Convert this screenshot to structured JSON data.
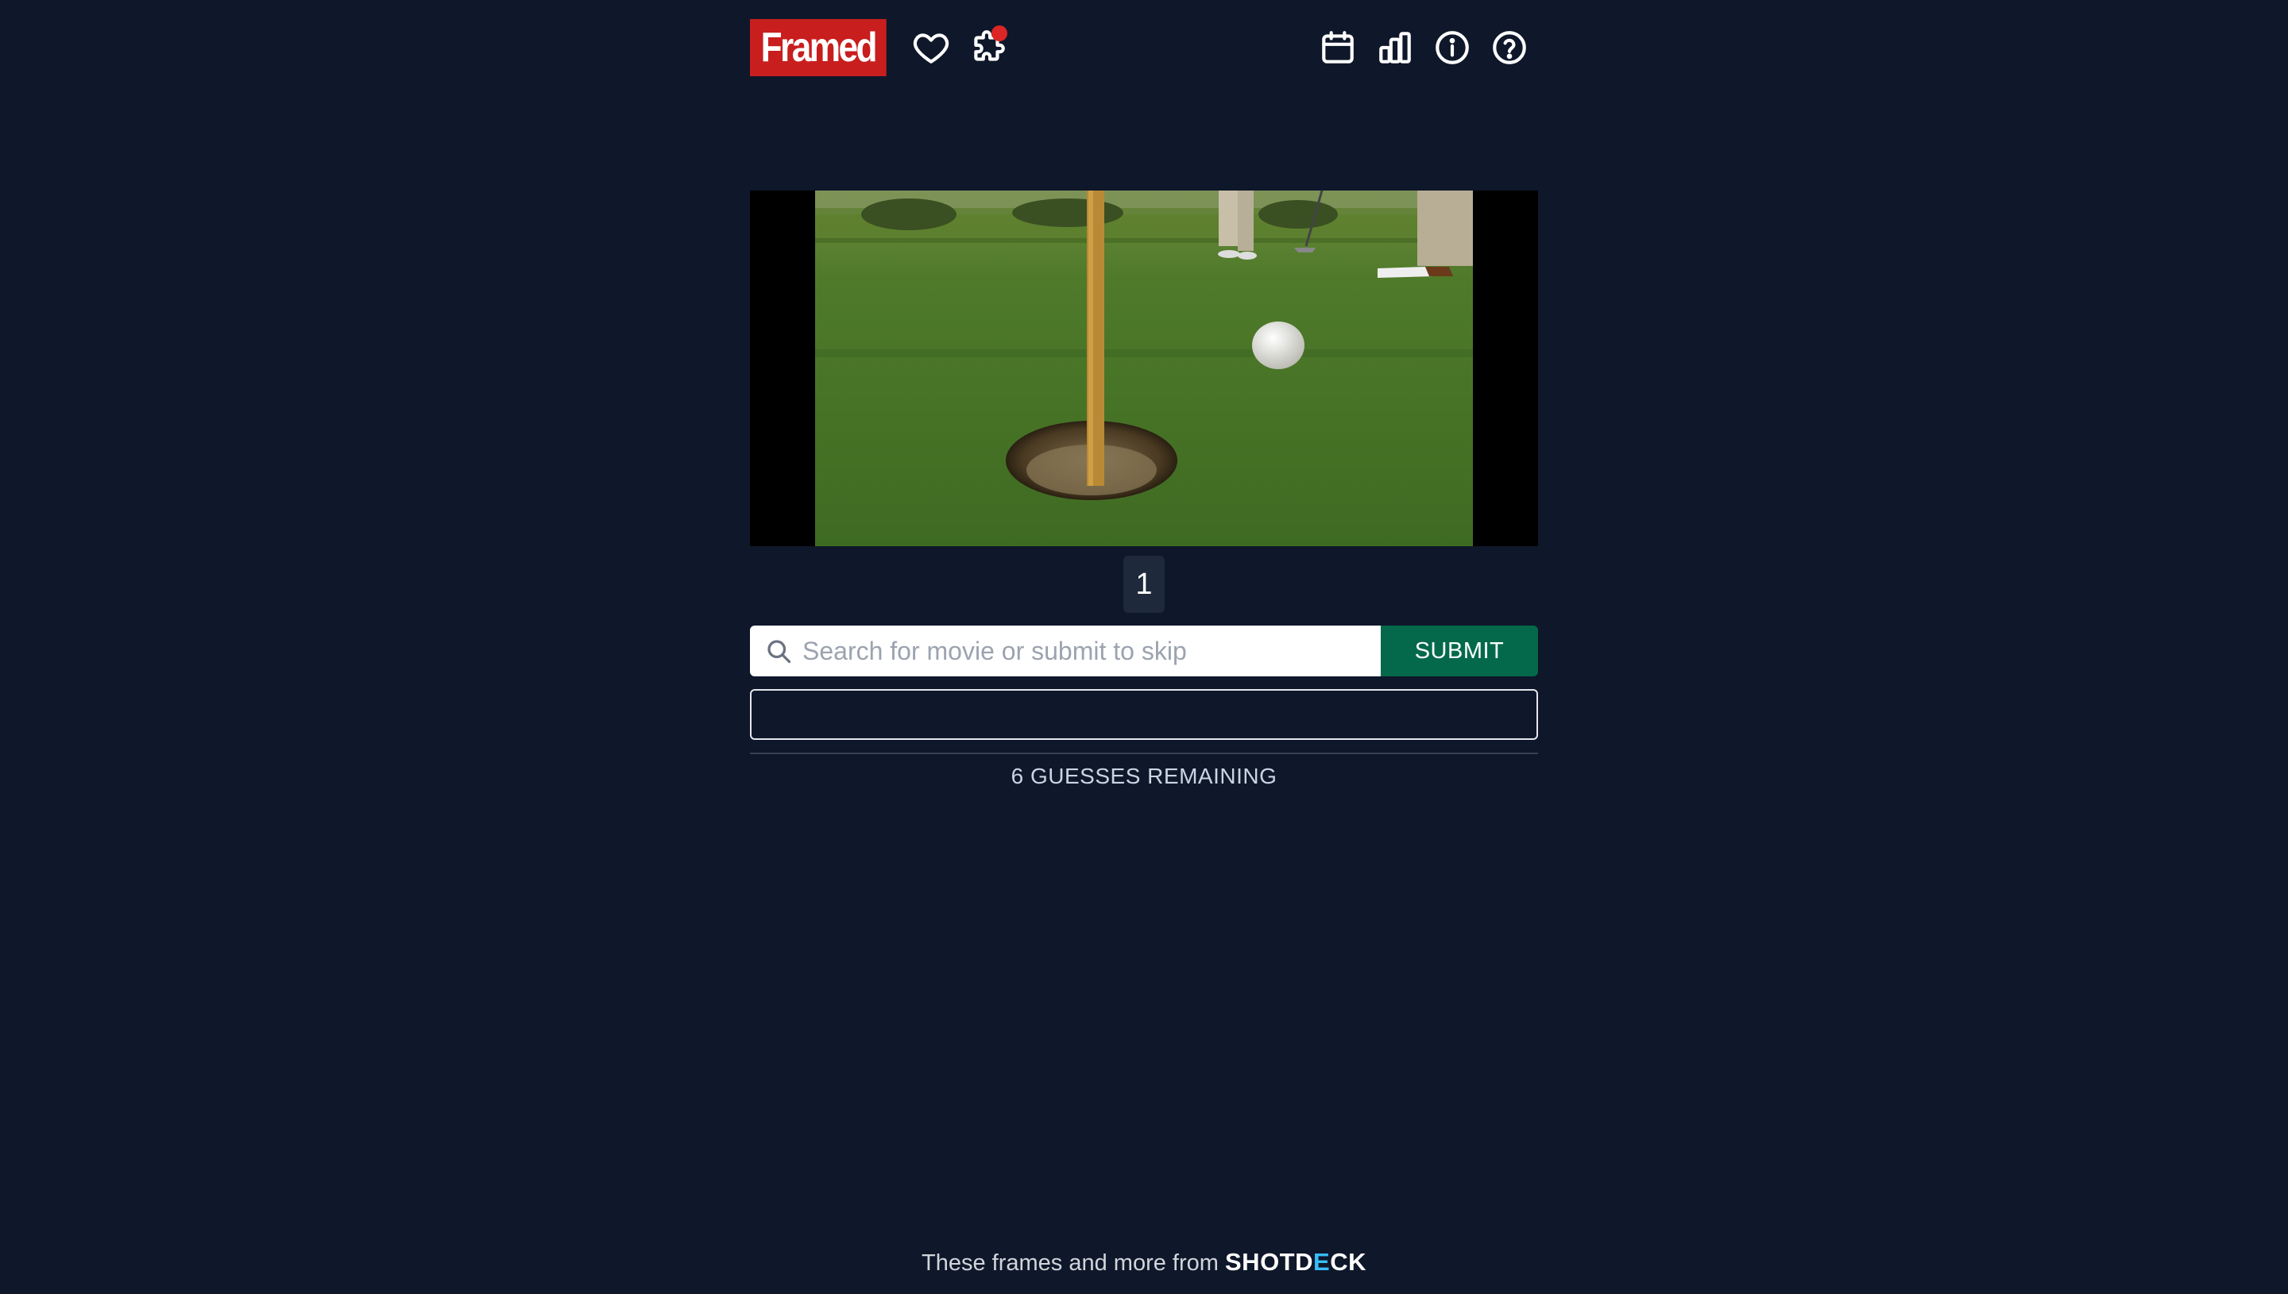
{
  "header": {
    "logo_text": "Framed",
    "left_icons": [
      "heart-icon",
      "puzzle-icon"
    ],
    "right_icons": [
      "calendar-icon",
      "stats-icon",
      "info-icon",
      "help-icon"
    ],
    "notification": true,
    "colors": {
      "logo_bg": "#c81e1e",
      "notification_dot": "#dc2626"
    }
  },
  "frame": {
    "alt": "Golf green with a flagstick in the cup and a golf ball rolling toward the hole",
    "tabs": [
      "1"
    ],
    "active_tab": "1"
  },
  "search": {
    "placeholder": "Search for movie or submit to skip",
    "value": "",
    "submit_label": "SUBMIT",
    "colors": {
      "submit_bg": "#04694a"
    }
  },
  "guesses": {
    "remaining_label": "6 GUESSES REMAINING",
    "slots": [
      ""
    ]
  },
  "footer": {
    "text": "These frames and more from",
    "brand_prefix": "SHOTD",
    "brand_accent": "E",
    "brand_suffix": "CK",
    "colors": {
      "brand_accent": "#38bdf8"
    }
  },
  "theme": {
    "background": "#0f172a"
  }
}
